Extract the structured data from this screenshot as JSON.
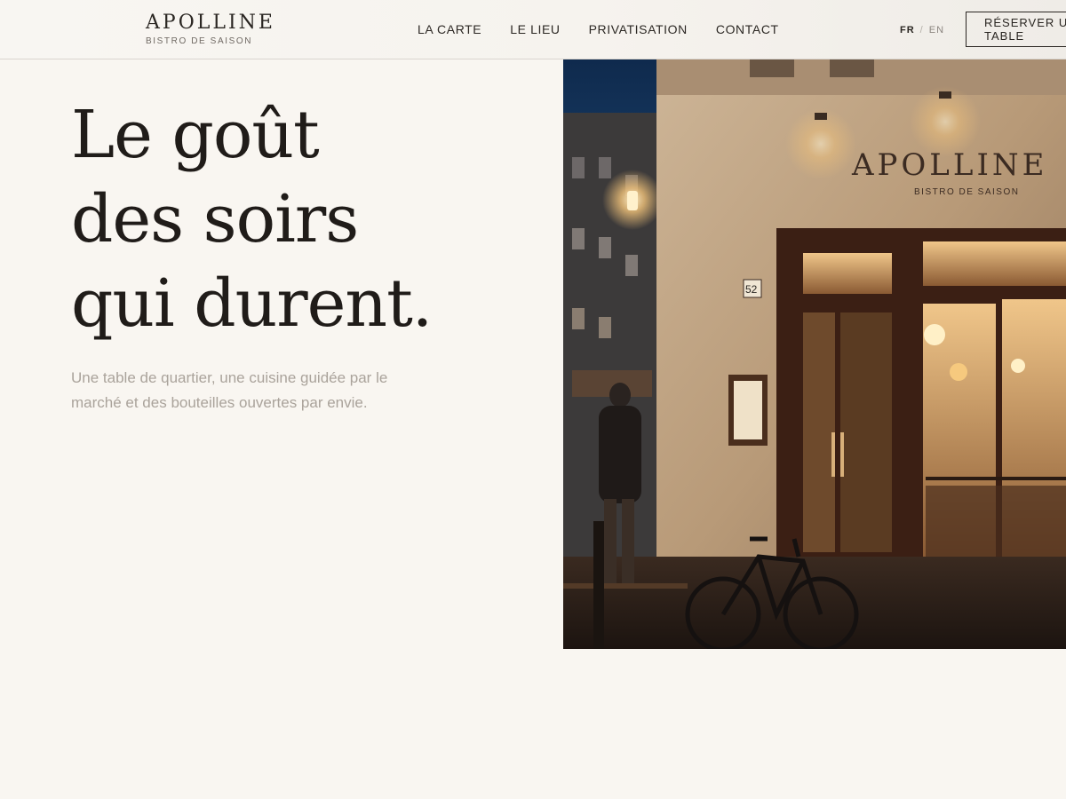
{
  "brand": {
    "name": "APOLLINE",
    "tagline": "BISTRO DE SAISON"
  },
  "nav": {
    "items": [
      {
        "label": "LA CARTE"
      },
      {
        "label": "LE LIEU"
      },
      {
        "label": "PRIVATISATION"
      },
      {
        "label": "CONTACT"
      }
    ]
  },
  "lang": {
    "current": "FR",
    "separator": "/",
    "other": "EN"
  },
  "cta": {
    "label": "RÉSERVER UNE TABLE"
  },
  "hero": {
    "title_lines": [
      "Le goût",
      "des soirs",
      "qui durent."
    ],
    "lead": "Une table de quartier, une cuisine guidée par le marché et des bouteilles ouvertes par envie.",
    "photo": {
      "sign_name": "APOLLINE",
      "sign_sub": "BISTRO DE SAISON",
      "street_number": "52"
    }
  },
  "colors": {
    "background": "#f9f6f1",
    "ink": "#201c19",
    "muted": "#aaa39b",
    "night_sky": "#143257",
    "warm_light": "#e8b673"
  }
}
